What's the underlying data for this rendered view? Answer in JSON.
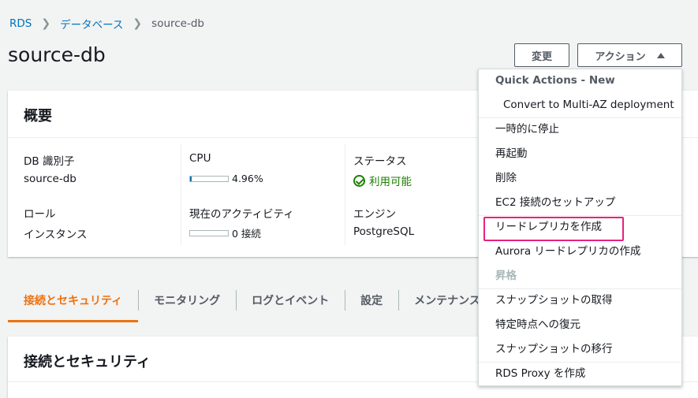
{
  "breadcrumb": {
    "root": "RDS",
    "parent": "データベース",
    "current": "source-db"
  },
  "page": {
    "title": "source-db"
  },
  "buttons": {
    "modify": "変更",
    "actions": "アクション"
  },
  "summary": {
    "heading": "概要",
    "db_identifier_label": "DB 識別子",
    "db_identifier_value": "source-db",
    "cpu_label": "CPU",
    "cpu_value": "4.96%",
    "cpu_fraction": 0.0496,
    "status_label": "ステータス",
    "status_value": "利用可能",
    "role_label": "ロール",
    "role_value": "インスタンス",
    "activity_label": "現在のアクティビティ",
    "activity_value": "0 接続",
    "activity_fraction": 0,
    "engine_label": "エンジン",
    "engine_value": "PostgreSQL"
  },
  "tabs": [
    "接続とセキュリティ",
    "モニタリング",
    "ログとイベント",
    "設定",
    "メンテナンス"
  ],
  "section2": {
    "heading": "接続とセキュリティ"
  },
  "dropdown": {
    "group_label": "Quick Actions - New",
    "quick_action": "Convert to Multi-AZ deployment",
    "items": [
      "一時的に停止",
      "再起動",
      "削除",
      "EC2 接続のセットアップ",
      "リードレプリカを作成",
      "Aurora リードレプリカの作成"
    ],
    "disabled_item": "昇格",
    "items2": [
      "スナップショットの取得",
      "特定時点への復元",
      "スナップショットの移行"
    ],
    "proxy_item": "RDS Proxy を作成"
  },
  "colors": {
    "link": "#0073bb",
    "accent": "#ec7211",
    "success": "#1d8102",
    "highlight": "#e6227e"
  }
}
